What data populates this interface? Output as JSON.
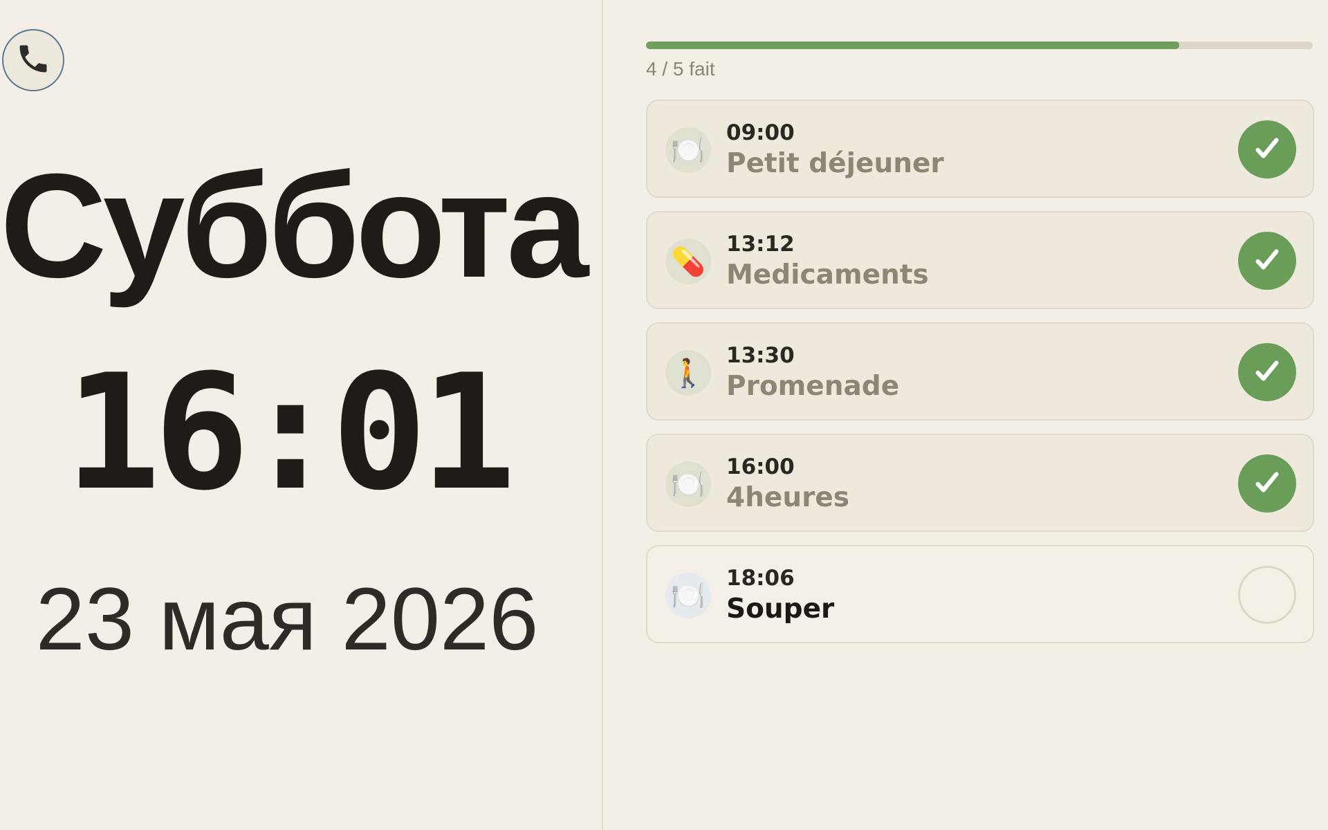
{
  "left": {
    "call_icon": "phone-icon",
    "weekday": "Суббота",
    "time": "16:01",
    "date": "23 мая 2026"
  },
  "progress": {
    "done": 4,
    "total": 5,
    "fraction": 0.8,
    "label": "4 / 5 fait",
    "fill_color": "#6f9e5d",
    "track_color": "#ddd6c8"
  },
  "tasks": [
    {
      "time": "09:00",
      "label": "Petit déjeuner",
      "icon": "🍽️",
      "icon_name": "plate-icon",
      "done": true
    },
    {
      "time": "13:12",
      "label": "Medicaments",
      "icon": "💊",
      "icon_name": "pill-icon",
      "done": true
    },
    {
      "time": "13:30",
      "label": "Promenade",
      "icon": "🚶",
      "icon_name": "walking-person-icon",
      "done": true
    },
    {
      "time": "16:00",
      "label": "4heures",
      "icon": "🍽️",
      "icon_name": "plate-icon",
      "done": true
    },
    {
      "time": "18:06",
      "label": "Souper",
      "icon": "🍽️",
      "icon_name": "plate-icon",
      "done": false
    }
  ],
  "colors": {
    "background": "#f3efe6",
    "done_green": "#6a9e58",
    "call_border": "#5b7794"
  }
}
